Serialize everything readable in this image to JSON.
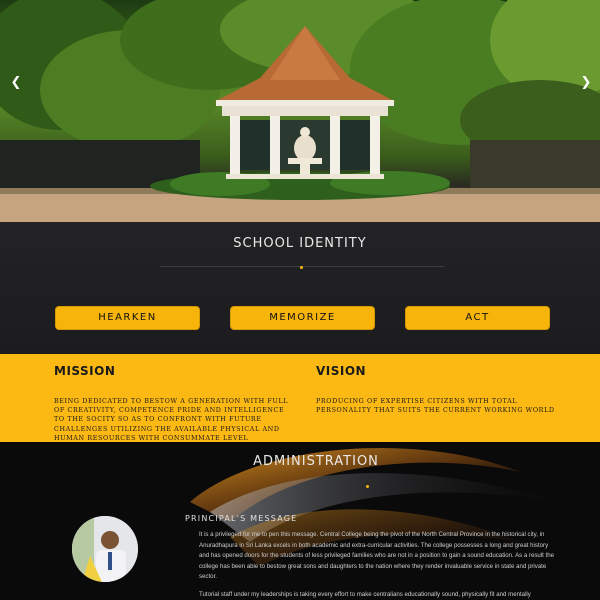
{
  "hero": {
    "prev_arrow": "❮",
    "next_arrow": "❯"
  },
  "identity": {
    "title": "SCHOOL IDENTITY",
    "buttons": [
      "HEARKEN",
      "MEMORIZE",
      "ACT"
    ]
  },
  "mission": {
    "heading": "MISSION",
    "text": "Being dedicated to bestow a generation with full of creativity, competence pride and intelligence to the socity so as to confront with future challenges utilizing the available physical and human resources with consummate level"
  },
  "vision": {
    "heading": "VISION",
    "text": "Producing of expertise citizens with total personality that suits the current working world"
  },
  "administration": {
    "title": "ADMINISTRATION",
    "principal_heading": "PRINCIPAL'S MESSAGE",
    "paragraph_1": "It is a privileged for me to pen this message. Central College being the pivot of the North Central Province in the historical city, in Anuradhapura in Sri Lanka excels in both academic and extra-curricular activities. The college possesses a long and great history and has opened doors for the students of less privileged families who are not in a position to gain a sound education. As a result the college has been able to bestow great sons and daughters to the nation where they render invaluable service in state and private sector.",
    "paragraph_2": "Tutorial staff under my leaderships is taking every effort to make centralians educationally sound, physically fit and mentally"
  },
  "colors": {
    "accent": "#fdb913",
    "dark_band": "#1e1e20",
    "background": "#0a0a0b"
  }
}
